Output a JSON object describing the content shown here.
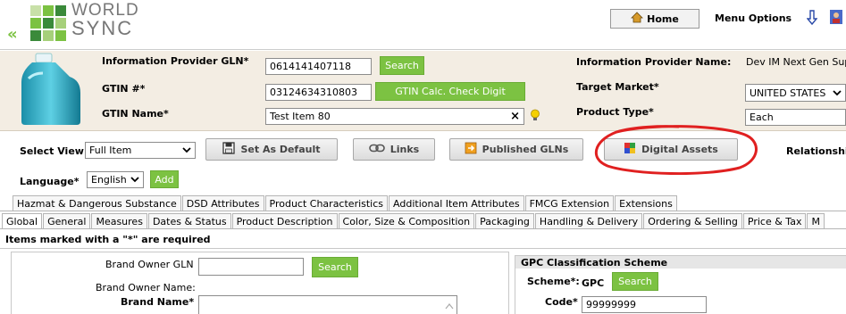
{
  "header": {
    "back_glyph": "«",
    "logo_line1": "WORLD",
    "logo_line2": "SYNC",
    "home_label": "Home",
    "menu_options_label": "Menu Options"
  },
  "info": {
    "gln_label": "Information Provider GLN*",
    "gln_value": "0614141407118",
    "search_label": "Search",
    "gtin_label": "GTIN #*",
    "gtin_value": "03124634310803",
    "gtin_calc_label": "GTIN Calc. Check Digit",
    "gtin_name_label": "GTIN Name*",
    "gtin_name_value": "Test Item 80",
    "clear_glyph": "×",
    "provider_name_label": "Information Provider Name:",
    "provider_name_value": "Dev IM Next Gen Sup",
    "target_market_label": "Target Market*",
    "target_market_value": "UNITED STATES",
    "product_type_label": "Product Type*",
    "product_type_value": "Each"
  },
  "toolbar": {
    "select_view_label": "Select View",
    "select_view_value": "Full Item",
    "set_default_label": "Set As Default",
    "links_label": "Links",
    "published_glns_label": "Published GLNs",
    "digital_assets_label": "Digital Assets",
    "relationship_label": "Relationshi",
    "language_label": "Language*",
    "language_value": "English",
    "add_label": "Add"
  },
  "tabs_row1": [
    "Hazmat & Dangerous Substance",
    "DSD Attributes",
    "Product Characteristics",
    "Additional Item Attributes",
    "FMCG Extension",
    "Extensions"
  ],
  "tabs_row2": [
    "Global",
    "General",
    "Measures",
    "Dates & Status",
    "Product Description",
    "Color, Size & Composition",
    "Packaging",
    "Handling & Delivery",
    "Ordering & Selling",
    "Price & Tax",
    "M"
  ],
  "required_note": "Items marked with a \"*\" are required",
  "form": {
    "brand_owner_gln_label": "Brand Owner GLN",
    "search_label": "Search",
    "brand_owner_name_label": "Brand Owner Name:",
    "brand_name_label": "Brand Name*",
    "gpc_title": "GPC Classification Scheme",
    "scheme_label": "Scheme*:",
    "scheme_value": "GPC",
    "gpc_search_label": "Search",
    "code_label": "Code*",
    "code_value": "99999999"
  },
  "colors": {
    "accent_green": "#7cc242",
    "annotation_red": "#e02020",
    "info_bg": "#f3ede3"
  }
}
